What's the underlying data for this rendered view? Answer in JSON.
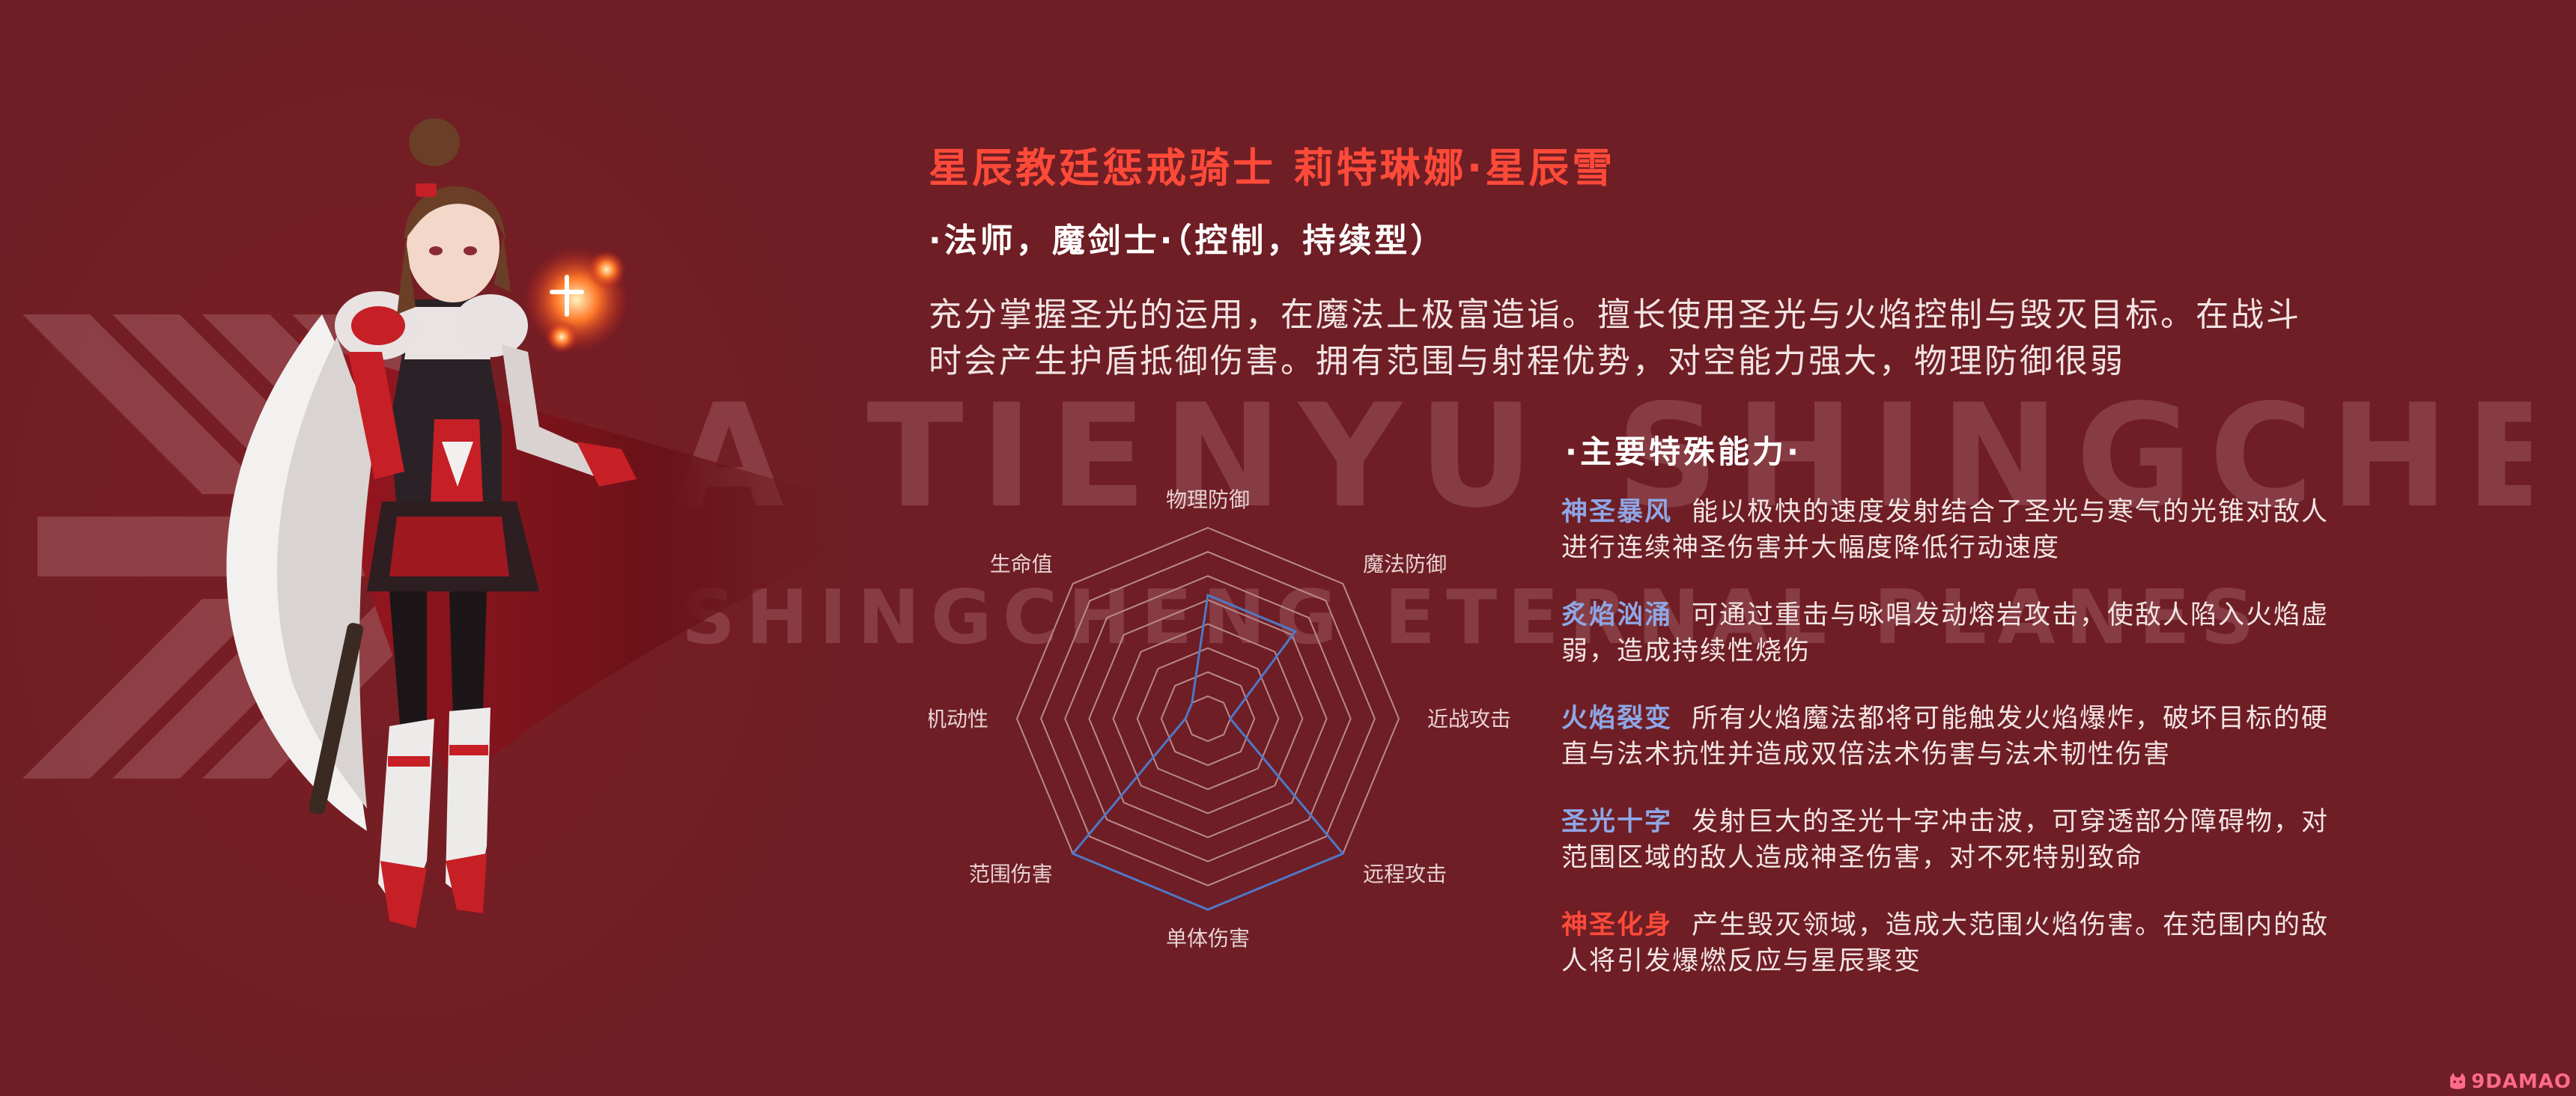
{
  "colors": {
    "background": "#6e1e24",
    "title": "#ff4a3a",
    "ability_name": "#8fa6e6",
    "ability_name_final": "#ff4a3a",
    "radar_grid": "#b98a8e",
    "radar_value": "#4f78c8"
  },
  "watermark": {
    "line1": "A TIENYU SHINGCHENG",
    "line2": "SHINGCHENG ETERNAL PLANES"
  },
  "header": {
    "title": "星辰教廷惩戒骑士  莉特琳娜·星辰雪",
    "subtitle": "·法师，魔剑士·（控制，持续型）"
  },
  "description": {
    "line1": "充分掌握圣光的运用，在魔法上极富造诣。擅长使用圣光与火焰控制与毁灭目标。在战斗",
    "line2": "时会产生护盾抵御伤害。拥有范围与射程优势，对空能力强大，物理防御很弱"
  },
  "radar": {
    "axes": [
      {
        "label": "物理防御",
        "value": 0.6
      },
      {
        "label": "魔法防御",
        "value": 0.6
      },
      {
        "label": "近战攻击",
        "value": 0.0
      },
      {
        "label": "远程攻击",
        "value": 1.0
      },
      {
        "label": "单体伤害",
        "value": 1.0
      },
      {
        "label": "范围伤害",
        "value": 1.0
      },
      {
        "label": "机动性",
        "value": 0.0
      },
      {
        "label": "生命值",
        "value": 0.0
      }
    ],
    "rings": 8
  },
  "abilities": {
    "heading": "·主要特殊能力·",
    "items": [
      {
        "name": "神圣暴风",
        "line1": "能以极快的速度发射结合了圣光与寒气的光锥对敌人",
        "line2": "进行连续神圣伤害并大幅度降低行动速度"
      },
      {
        "name": "炙焰汹涌",
        "line1": "可通过重击与咏唱发动熔岩攻击，使敌人陷入火焰虚",
        "line2": "弱，造成持续性烧伤"
      },
      {
        "name": "火焰裂变",
        "line1": "所有火焰魔法都将可能触发火焰爆炸，破坏目标的硬",
        "line2": "直与法术抗性并造成双倍法术伤害与法术韧性伤害"
      },
      {
        "name": "圣光十字",
        "line1": "发射巨大的圣光十字冲击波，可穿透部分障碍物，对",
        "line2": "范围区域的敌人造成神圣伤害，对不死特别致命"
      },
      {
        "name": "神圣化身",
        "line1": "产生毁灭领域，造成大范围火焰伤害。在范围内的敌",
        "line2": "人将引发爆燃反应与星辰聚变"
      }
    ]
  },
  "logo": {
    "text": "9DAMAO",
    "icon": "cat-icon"
  }
}
